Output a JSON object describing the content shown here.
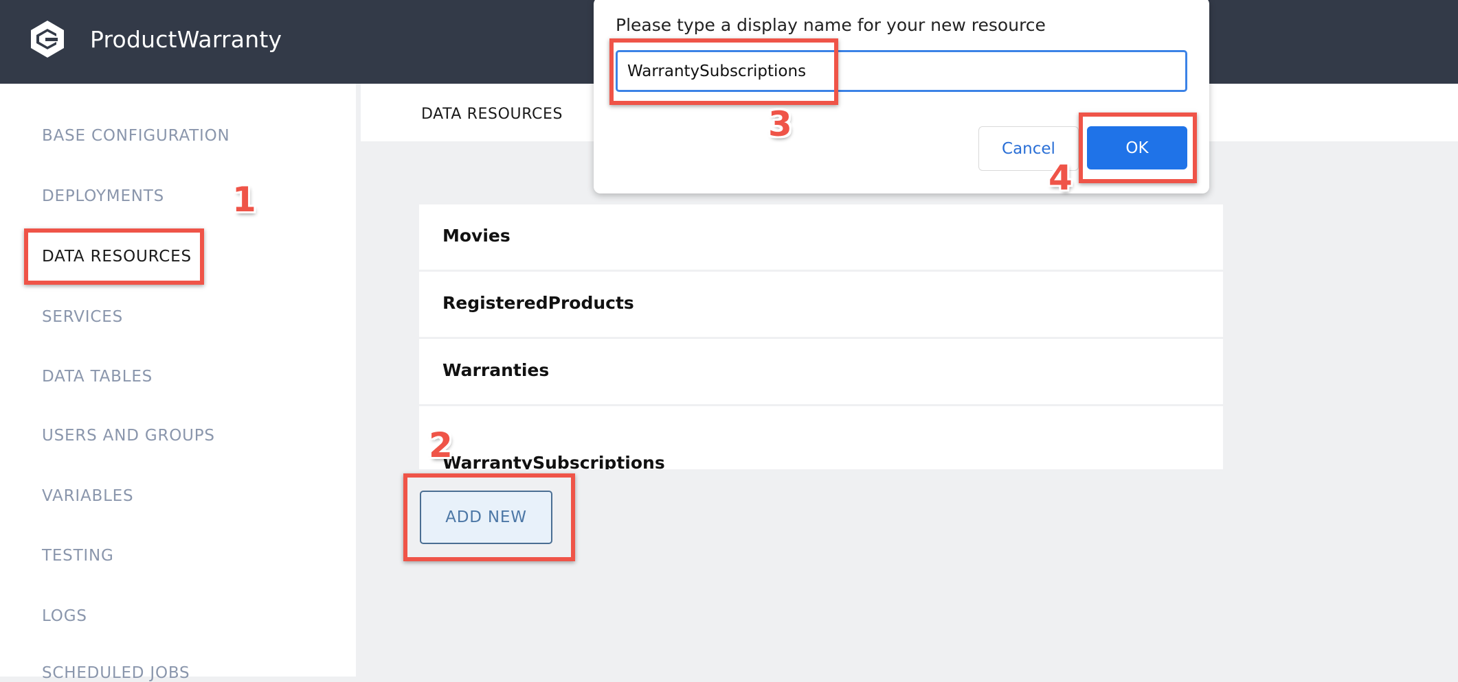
{
  "app": {
    "title": "ProductWarranty",
    "logo_icon": "app-logo-icon"
  },
  "sidebar": {
    "items": [
      {
        "label": "BASE CONFIGURATION",
        "active": false
      },
      {
        "label": "DEPLOYMENTS",
        "active": false
      },
      {
        "label": "DATA RESOURCES",
        "active": true
      },
      {
        "label": "SERVICES",
        "active": false
      },
      {
        "label": "DATA TABLES",
        "active": false
      },
      {
        "label": "USERS AND GROUPS",
        "active": false
      },
      {
        "label": "VARIABLES",
        "active": false
      },
      {
        "label": "TESTING",
        "active": false
      },
      {
        "label": "LOGS",
        "active": false
      },
      {
        "label": "SCHEDULED JOBS",
        "active": false
      }
    ]
  },
  "main": {
    "section_title": "DATA RESOURCES",
    "resources": [
      "Movies",
      "RegisteredProducts",
      "Warranties",
      "WarrantySubscriptions"
    ],
    "add_new_label": "ADD NEW"
  },
  "dialog": {
    "prompt": "Please type a display name for your new resource",
    "input_value": "WarrantySubscriptions",
    "cancel_label": "Cancel",
    "ok_label": "OK"
  },
  "annotations": {
    "steps": [
      "1",
      "2",
      "3",
      "4"
    ],
    "highlight_color": "#ef5448"
  },
  "colors": {
    "topbar": "#333a48",
    "primary_button": "#1f73e8",
    "nav_inactive": "#8a96ac"
  }
}
